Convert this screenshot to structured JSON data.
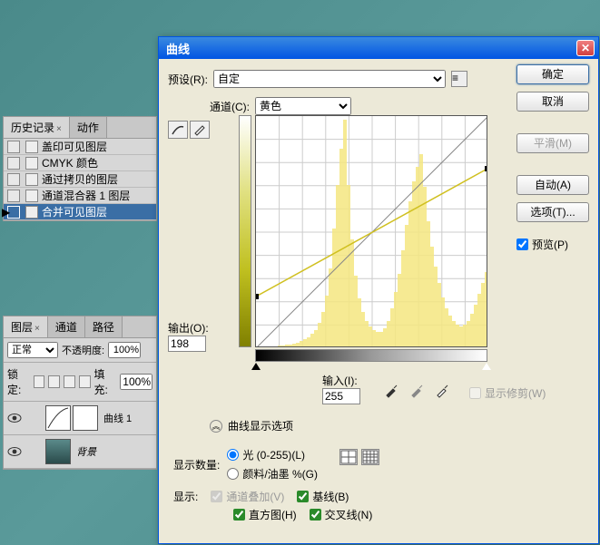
{
  "history": {
    "tabs": [
      "历史记录",
      "动作"
    ],
    "items": [
      {
        "label": "盖印可见图层"
      },
      {
        "label": "CMYK 颜色"
      },
      {
        "label": "通过拷贝的图层"
      },
      {
        "label": "通道混合器 1 图层"
      },
      {
        "label": "合并可见图层",
        "selected": true
      }
    ]
  },
  "layers": {
    "tabs": [
      "图层",
      "通道",
      "路径"
    ],
    "blend": "正常",
    "opacity_label": "不透明度:",
    "opacity_value": "100%",
    "lock_label": "锁定:",
    "fill_label": "填充:",
    "fill_value": "100%",
    "items": [
      {
        "name": "曲线 1"
      },
      {
        "name": "背景"
      }
    ]
  },
  "dialog": {
    "title": "曲线",
    "preset_label": "预设(R):",
    "preset_value": "自定",
    "channel_label": "通道(C):",
    "channel_value": "黄色",
    "output_label": "输出(O):",
    "output_value": "198",
    "input_label": "输入(I):",
    "input_value": "255",
    "show_clip": "显示修剪(W)",
    "disp_opts": "曲线显示选项",
    "amount_label": "显示数量:",
    "amount_light": "光 (0-255)(L)",
    "amount_ink": "颜料/油墨 %(G)",
    "show_label": "显示:",
    "overlay": "通道叠加(V)",
    "baseline": "基线(B)",
    "histogram": "直方图(H)",
    "intersect": "交叉线(N)",
    "ok": "确定",
    "cancel": "取消",
    "smooth": "平滑(M)",
    "auto": "自动(A)",
    "options": "选项(T)...",
    "preview": "预览(P)"
  },
  "chart_data": {
    "type": "line",
    "title": "曲线 — 黄色通道",
    "xlabel": "输入",
    "ylabel": "输出",
    "xlim": [
      0,
      255
    ],
    "ylim": [
      0,
      255
    ],
    "series": [
      {
        "name": "baseline",
        "x": [
          0,
          255
        ],
        "y": [
          0,
          255
        ]
      },
      {
        "name": "curve",
        "x": [
          0,
          255
        ],
        "y": [
          57,
          198
        ]
      }
    ],
    "points": [
      {
        "x": 0,
        "y": 57
      },
      {
        "x": 255,
        "y": 198
      }
    ],
    "histogram": [
      0,
      0,
      0,
      0,
      0,
      2,
      3,
      3,
      4,
      4,
      5,
      6,
      8,
      10,
      12,
      16,
      20,
      28,
      40,
      58,
      88,
      132,
      180,
      220,
      252,
      180,
      120,
      80,
      55,
      40,
      30,
      24,
      20,
      18,
      18,
      22,
      30,
      44,
      62,
      82,
      108,
      136,
      162,
      184,
      200,
      214,
      178,
      140,
      112,
      90,
      72,
      56,
      44,
      36,
      30,
      26,
      24,
      26,
      30,
      38,
      48,
      60,
      72,
      84
    ]
  }
}
